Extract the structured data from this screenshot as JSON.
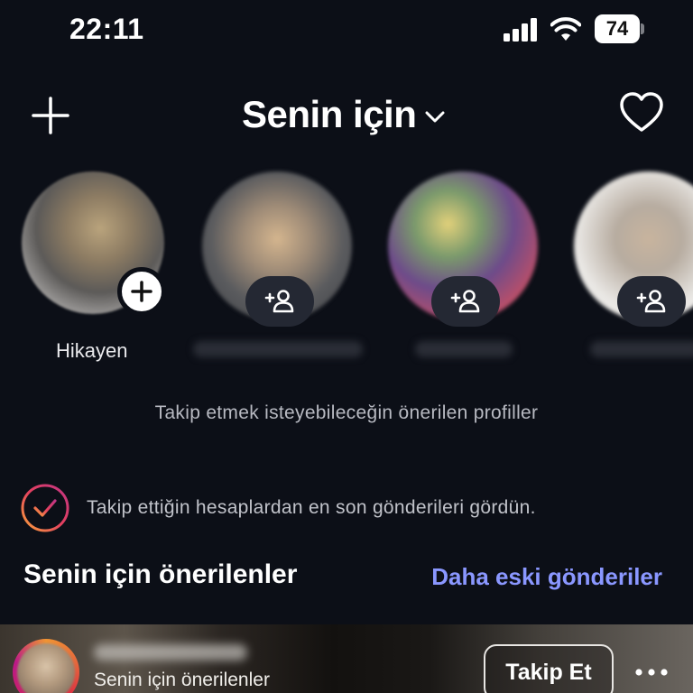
{
  "status_bar": {
    "time": "22:11",
    "battery": "74"
  },
  "header": {
    "title": "Senin için",
    "left_icon": "plus-icon",
    "right_icon": "heart-icon"
  },
  "stories": {
    "own": {
      "label": "Hikayen",
      "badge_icon": "plus-icon"
    },
    "suggested": [
      {
        "action_icon": "add-person-icon"
      },
      {
        "action_icon": "add-person-icon"
      },
      {
        "action_icon": "add-person-icon"
      }
    ],
    "caption": "Takip etmek isteyebileceğin önerilen profiller"
  },
  "caught_up": {
    "text": "Takip ettiğin hesaplardan en son gönderileri gördün.",
    "icon": "checkmark-ring-icon"
  },
  "section": {
    "title": "Senin için önerilenler",
    "link": "Daha eski gönderiler",
    "link_color": "#8a97ff"
  },
  "post": {
    "subtitle": "Senin için önerilenler",
    "follow_label": "Takip Et",
    "more_icon": "more-dots-icon"
  },
  "colors": {
    "background": "#0c0f17",
    "chip": "#242833",
    "accent_link": "#8a97ff"
  }
}
